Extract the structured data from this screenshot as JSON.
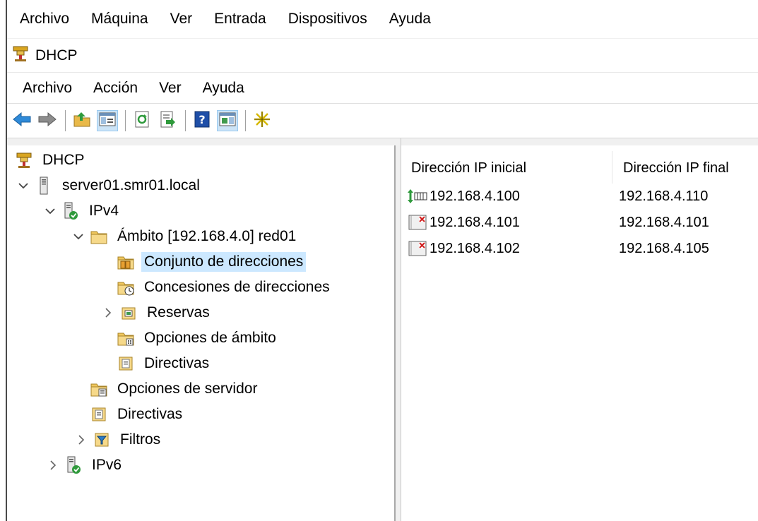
{
  "vm_menu": [
    "Archivo",
    "Máquina",
    "Ver",
    "Entrada",
    "Dispositivos",
    "Ayuda"
  ],
  "window": {
    "title": "DHCP"
  },
  "mmc_menu": [
    "Archivo",
    "Acción",
    "Ver",
    "Ayuda"
  ],
  "toolbar": {
    "buttons": [
      "back-arrow-icon",
      "forward-arrow-icon",
      "up-folder-icon",
      "show-hide-tree-icon",
      "refresh-icon",
      "export-list-icon",
      "help-icon",
      "action-pane-icon",
      "new-item-star-icon"
    ]
  },
  "tree": {
    "root": "DHCP",
    "server": "server01.smr01.local",
    "ipv4": "IPv4",
    "scope": "Ámbito [192.168.4.0] red01",
    "address_pool": "Conjunto de direcciones",
    "leases": "Concesiones de direcciones",
    "reservations": "Reservas",
    "scope_options": "Opciones de ámbito",
    "scope_policies": "Directivas",
    "server_options": "Opciones de servidor",
    "policies": "Directivas",
    "filters": "Filtros",
    "ipv6": "IPv6"
  },
  "list": {
    "columns": [
      "Dirección IP inicial",
      "Dirección IP final"
    ],
    "rows": [
      {
        "start": "192.168.4.100",
        "end": "192.168.4.110",
        "icon": "address-range-icon"
      },
      {
        "start": "192.168.4.101",
        "end": "192.168.4.101",
        "icon": "exclusion-range-icon"
      },
      {
        "start": "192.168.4.102",
        "end": "192.168.4.105",
        "icon": "exclusion-range-icon"
      }
    ]
  },
  "colors": {
    "selection": "#cce8ff",
    "toolbar_pressed": "#cce4f7",
    "folder": "#f0c75e"
  }
}
